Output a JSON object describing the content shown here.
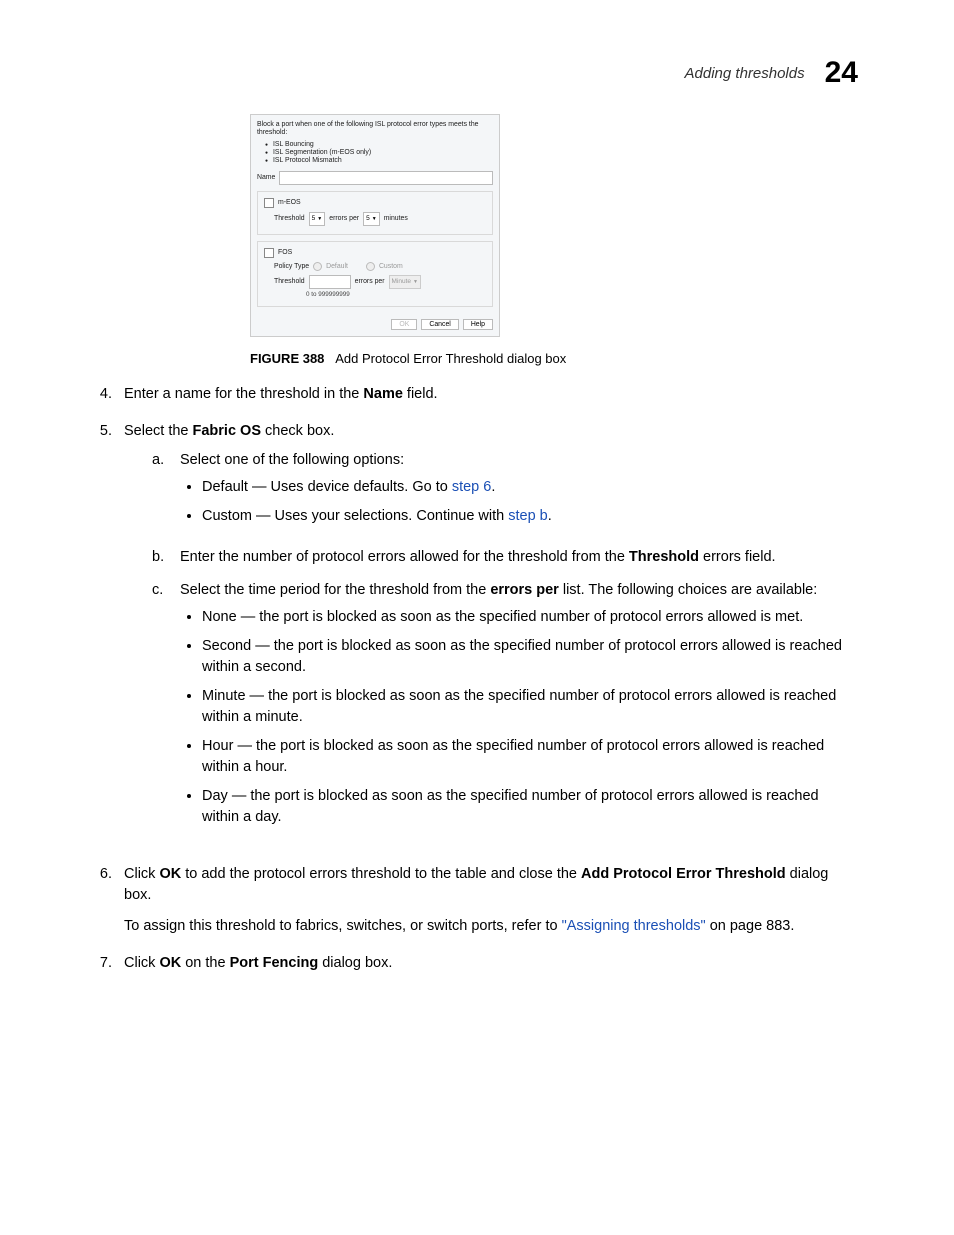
{
  "header": {
    "section_title": "Adding thresholds",
    "chapter_number": "24"
  },
  "dialog": {
    "intro": "Block a port when one of the following ISL protocol error types meets the threshold:",
    "intro_items": [
      "ISL Bouncing",
      "ISL Segmentation (m-EOS only)",
      "ISL Protocol Mismatch"
    ],
    "name_label": "Name",
    "name_value": "",
    "meos": {
      "label": "m-EOS",
      "threshold_label": "Threshold",
      "threshold_value": "5",
      "errors_per_label": "errors per",
      "period_value": "5",
      "unit_label": "minutes"
    },
    "fos": {
      "label": "FOS",
      "policy_type_label": "Policy Type",
      "default_label": "Default",
      "custom_label": "Custom",
      "threshold_label": "Threshold",
      "threshold_value": "",
      "errors_per_label": "errors per",
      "period_label": "Minute",
      "hint": "0 to 999999999"
    },
    "buttons": {
      "ok": "OK",
      "cancel": "Cancel",
      "help": "Help"
    }
  },
  "figure": {
    "number": "FIGURE 388",
    "caption": "Add Protocol Error Threshold dialog box"
  },
  "steps": {
    "s4": {
      "num": "4.",
      "t1": "Enter a name for the threshold in the ",
      "b1": "Name",
      "t2": " field."
    },
    "s5": {
      "num": "5.",
      "t1": "Select the ",
      "b1": "Fabric OS",
      "t2": " check box.",
      "a": {
        "k": "a.",
        "text": "Select one of the following options:",
        "opt1_pre": "Default — Uses device defaults. Go to ",
        "opt1_link": "step 6",
        "opt1_post": ".",
        "opt2_pre": "Custom — Uses your selections. Continue with ",
        "opt2_link": "step b",
        "opt2_post": "."
      },
      "b": {
        "k": "b.",
        "t1": "Enter the number of protocol errors allowed for the threshold from the ",
        "b1": "Threshold",
        "t2": " errors field."
      },
      "c": {
        "k": "c.",
        "t1": "Select the time period for the threshold from the ",
        "b1": "errors per",
        "t2": " list. The following choices are available:",
        "items": [
          "None — the port is blocked as soon as the specified number of protocol errors allowed is met.",
          "Second — the port is blocked as soon as the specified number of protocol errors allowed is reached within a second.",
          "Minute — the port is blocked as soon as the specified number of protocol errors allowed is reached within a minute.",
          "Hour — the port is blocked as soon as the specified number of protocol errors allowed is reached within a hour.",
          "Day — the port is blocked as soon as the specified number of protocol errors allowed is reached within a day."
        ]
      }
    },
    "s6": {
      "num": "6.",
      "t1": "Click ",
      "b1": "OK",
      "t2": " to add the protocol errors threshold to the table and close the ",
      "b2": "Add Protocol Error Threshold",
      "t3": " dialog box.",
      "p2a": "To assign this threshold to fabrics, switches, or switch ports, refer to ",
      "p2link": "\"Assigning thresholds\"",
      "p2b": " on page 883."
    },
    "s7": {
      "num": "7.",
      "t1": "Click ",
      "b1": "OK",
      "t2": " on the ",
      "b2": "Port Fencing",
      "t3": " dialog box."
    }
  }
}
